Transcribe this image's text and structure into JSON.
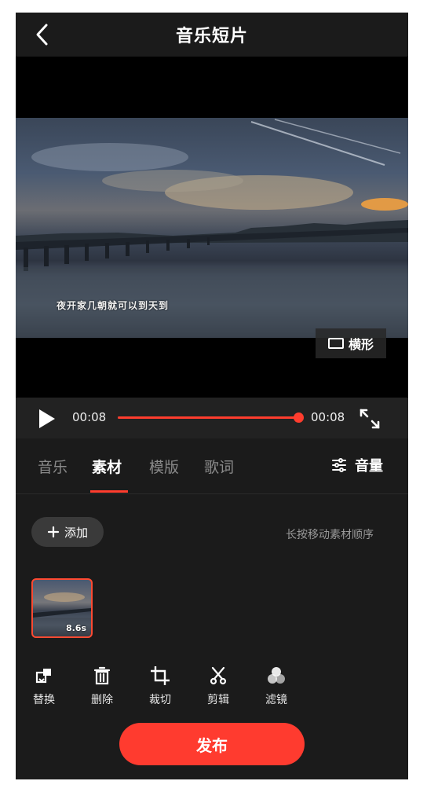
{
  "header": {
    "title": "音乐短片"
  },
  "video": {
    "subtitle": "夜开家几朝就可以到天到",
    "orientation_label": "横形"
  },
  "playback": {
    "current_time": "00:08",
    "total_time": "00:08",
    "progress": 1.0
  },
  "tabs": [
    {
      "label": "音乐",
      "active": false
    },
    {
      "label": "素材",
      "active": true
    },
    {
      "label": "模版",
      "active": false
    },
    {
      "label": "歌词",
      "active": false
    }
  ],
  "volume": {
    "label": "音量"
  },
  "materials": {
    "add_label": "添加",
    "hint": "长按移动素材顺序",
    "clips": [
      {
        "duration": "8.6s",
        "selected": true
      }
    ]
  },
  "tools": [
    {
      "label": "替换",
      "icon": "replace-icon"
    },
    {
      "label": "删除",
      "icon": "trash-icon"
    },
    {
      "label": "裁切",
      "icon": "crop-icon"
    },
    {
      "label": "剪辑",
      "icon": "scissors-icon"
    },
    {
      "label": "滤镜",
      "icon": "filter-icon"
    }
  ],
  "publish": {
    "label": "发布"
  },
  "colors": {
    "accent": "#ff3b2f",
    "background": "#1b1b1b"
  }
}
